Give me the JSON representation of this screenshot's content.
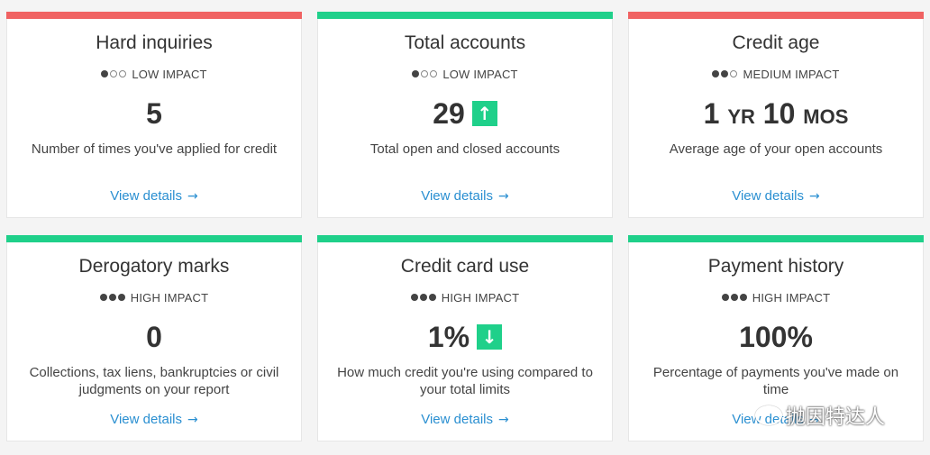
{
  "cards": [
    {
      "title": "Hard inquiries",
      "impact": "LOW IMPACT",
      "impact_level": 1,
      "value": "5",
      "arrow": null,
      "description": "Number of times you've applied for credit",
      "link": "View details",
      "bar_color": "#f06262"
    },
    {
      "title": "Total accounts",
      "impact": "LOW IMPACT",
      "impact_level": 1,
      "value": "29",
      "arrow": "up",
      "description": "Total open and closed accounts",
      "link": "View details",
      "bar_color": "#1fd08a"
    },
    {
      "title": "Credit age",
      "impact": "MEDIUM IMPACT",
      "impact_level": 2,
      "value_parts": [
        "1",
        "YR",
        "10",
        "MOS"
      ],
      "arrow": null,
      "description": "Average age of your open accounts",
      "link": "View details",
      "bar_color": "#f06262"
    },
    {
      "title": "Derogatory marks",
      "impact": "HIGH IMPACT",
      "impact_level": 3,
      "value": "0",
      "arrow": null,
      "description": "Collections, tax liens, bankruptcies or civil judgments on your report",
      "link": "View details",
      "bar_color": "#1fd08a"
    },
    {
      "title": "Credit card use",
      "impact": "HIGH IMPACT",
      "impact_level": 3,
      "value": "1%",
      "arrow": "down",
      "description": "How much credit you're using compared to your total limits",
      "link": "View details",
      "bar_color": "#1fd08a"
    },
    {
      "title": "Payment history",
      "impact": "HIGH IMPACT",
      "impact_level": 3,
      "value": "100%",
      "arrow": null,
      "description": "Percentage of payments you've made on time",
      "link": "View details",
      "bar_color": "#1fd08a"
    }
  ],
  "arrow_color": "#1fd08a",
  "link_color": "#2a8fd1",
  "watermark": "抛因特达人"
}
